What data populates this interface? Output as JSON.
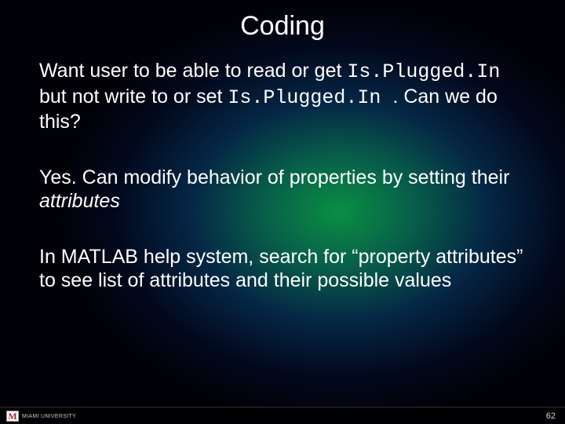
{
  "title": "Coding",
  "p1": {
    "t1": "Want user to be able to read or get ",
    "code1": "Is.Plugged.In",
    "t2": " but not write to or set ",
    "code2": "Is.Plugged.In ",
    "t3": ". Can we do this?"
  },
  "p2": {
    "t1": "Yes. Can modify behavior of properties by setting their ",
    "em": "attributes"
  },
  "p3": {
    "t1": "In MATLAB help system, search for “property attributes” to see list of attributes and their possible values"
  },
  "footer": {
    "logo_mark": "M",
    "logo_text": "MIAMI UNIVERSITY",
    "page": "62"
  }
}
